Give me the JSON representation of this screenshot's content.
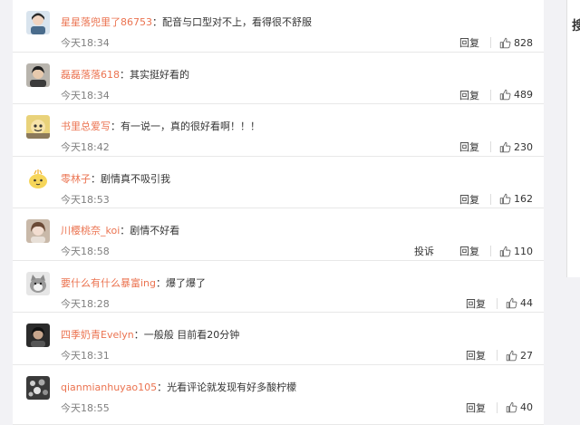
{
  "sidebar": {
    "label": "搜"
  },
  "icons": {
    "like": "thumbs-up-icon"
  },
  "comments": [
    {
      "user": "星星落兜里了86753",
      "text": "配音与口型对不上，看得很不舒服",
      "time": "今天18:34",
      "reply": "回复",
      "likes": "828"
    },
    {
      "user": "磊磊落落618",
      "text": "其实挺好看的",
      "time": "今天18:34",
      "reply": "回复",
      "likes": "489"
    },
    {
      "user": "书里总爱写",
      "text": "有一说一，真的很好看啊！！！",
      "time": "今天18:42",
      "reply": "回复",
      "likes": "230"
    },
    {
      "user": "零林子",
      "text": "剧情真不吸引我",
      "time": "今天18:53",
      "reply": "回复",
      "likes": "162"
    },
    {
      "user": "川樱桃奈_koi",
      "text": "剧情不好看",
      "time": "今天18:58",
      "report": "投诉",
      "reply": "回复",
      "likes": "110"
    },
    {
      "user": "要什么有什么暴富ing",
      "text": "爆了爆了",
      "time": "今天18:28",
      "reply": "回复",
      "likes": "44"
    },
    {
      "user": "四季奶青Evelyn",
      "text": "一般般 目前看20分钟",
      "time": "今天18:31",
      "reply": "回复",
      "likes": "27"
    },
    {
      "user": "qianmianhuyao105",
      "text": "光看评论就发现有好多酸柠檬",
      "time": "今天18:55",
      "reply": "回复",
      "likes": "40"
    }
  ]
}
